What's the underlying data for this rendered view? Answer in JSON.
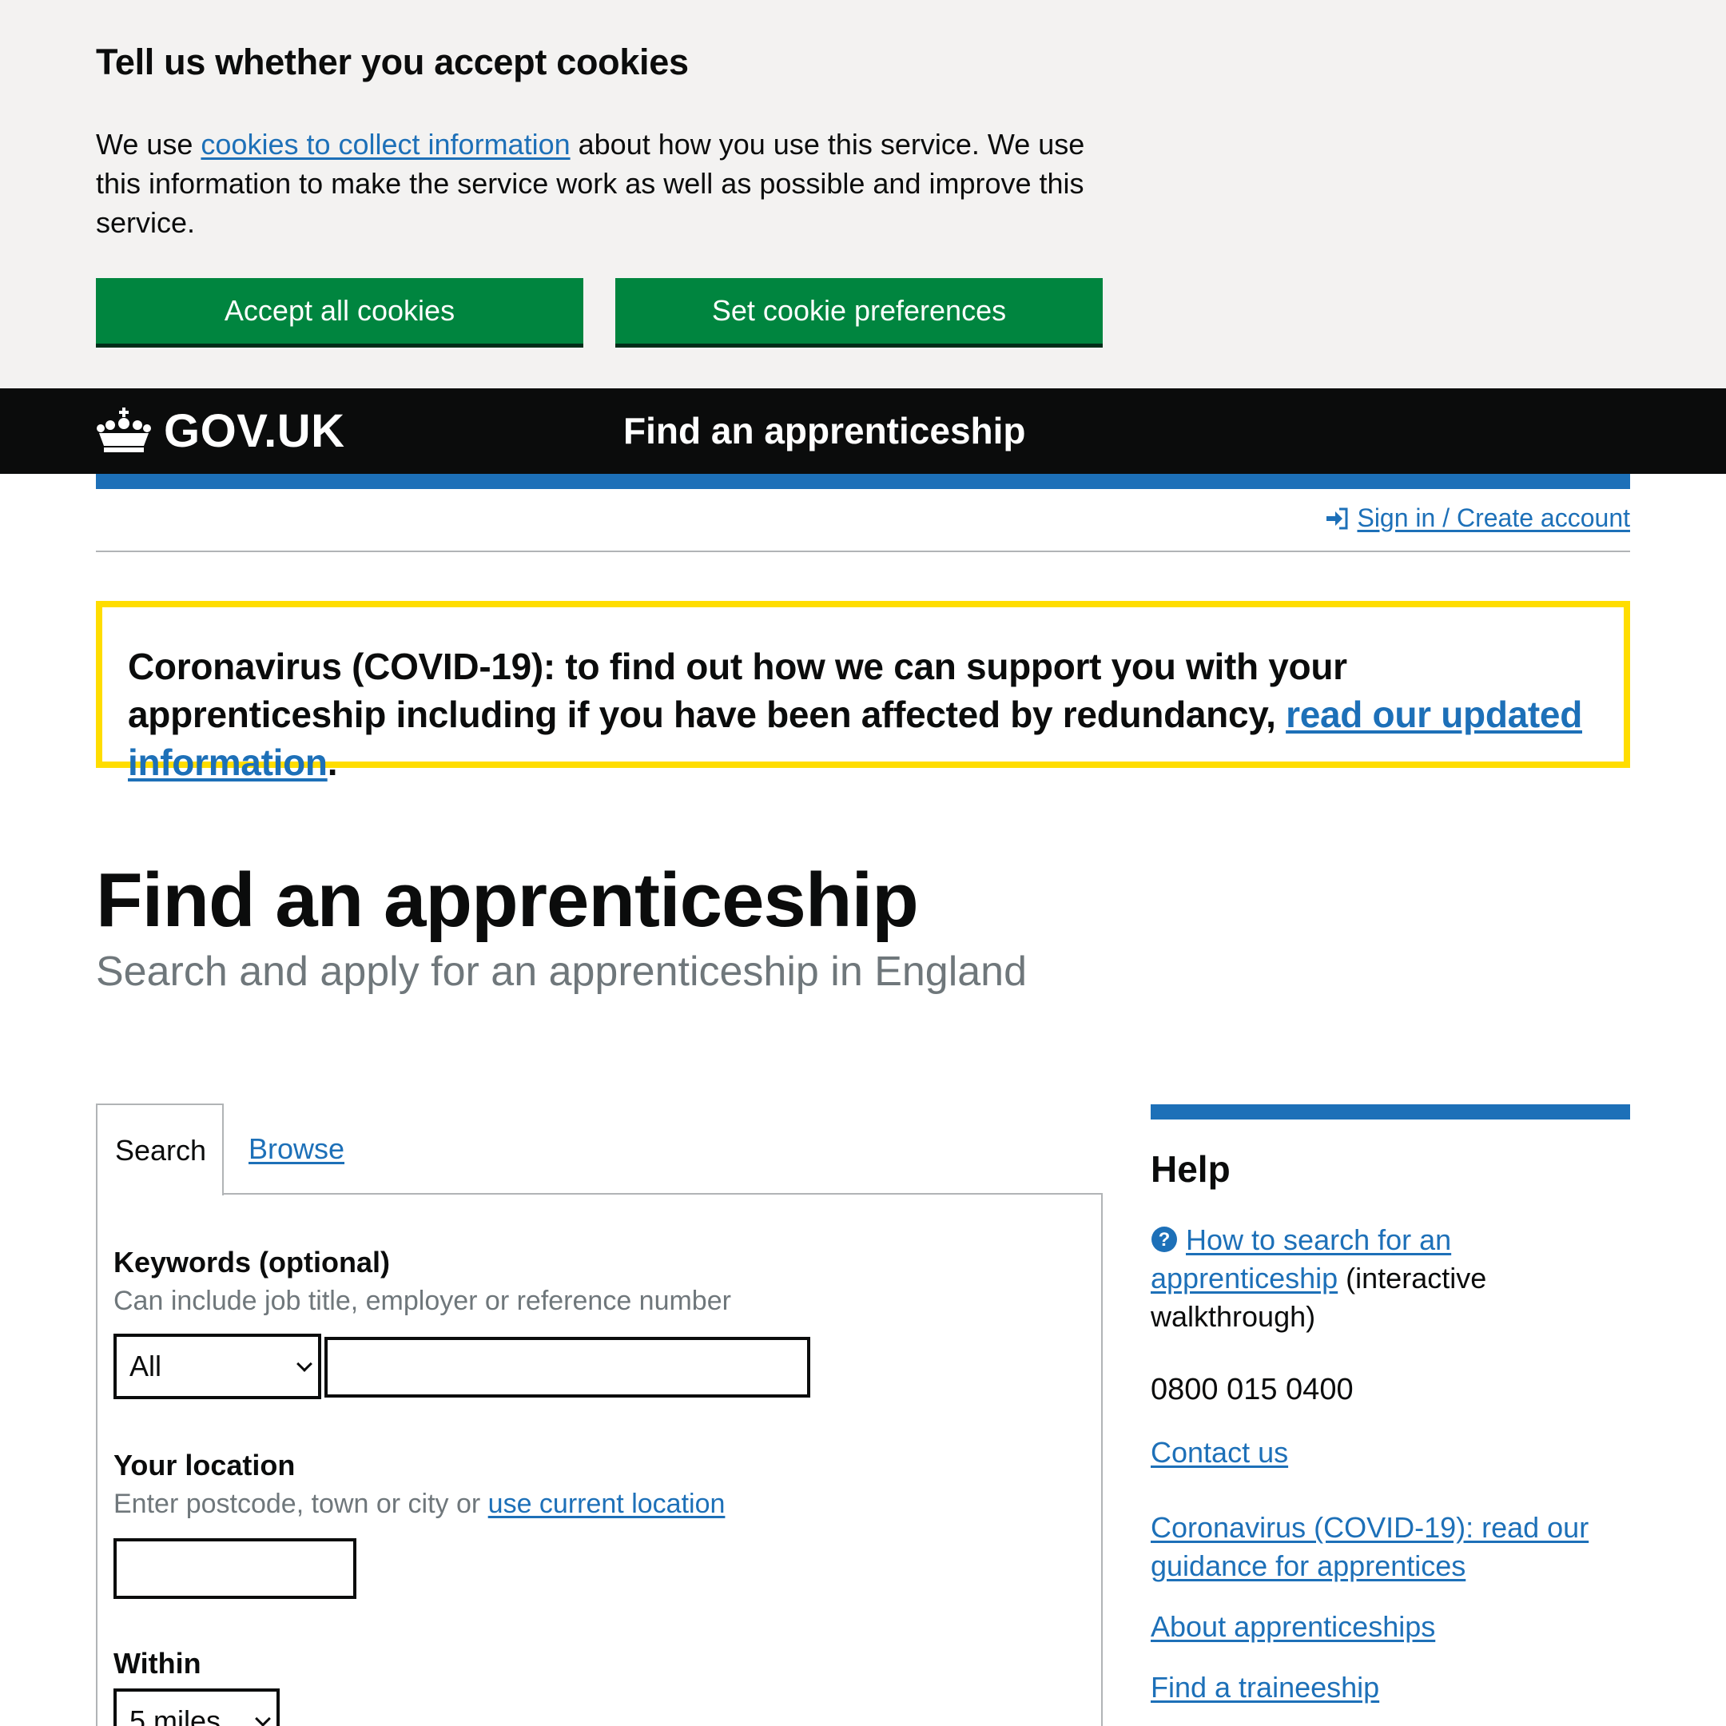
{
  "cookie_banner": {
    "title": "Tell us whether you accept cookies",
    "text_before": "We use ",
    "link_text": "cookies to collect information",
    "text_after": " about how you use this service. We use this information to make the service work as well as possible and improve this service.",
    "accept_label": "Accept all cookies",
    "prefs_label": "Set cookie preferences"
  },
  "header": {
    "logo_text": "GOV.UK",
    "service_name": "Find an apprenticeship"
  },
  "account_nav": {
    "signin_label": "Sign in / Create account"
  },
  "covid_banner": {
    "text": "Coronavirus (COVID-19): to find out how we can support you with your apprenticeship including if you have been affected by redundancy, ",
    "link_text": "read our updated information",
    "end": "."
  },
  "main": {
    "title": "Find an apprenticeship",
    "subtitle": "Search and apply for an apprenticeship in England"
  },
  "tabs": [
    {
      "label": "Search",
      "selected": true
    },
    {
      "label": "Browse",
      "selected": false
    }
  ],
  "search_form": {
    "keywords_label": "Keywords (optional)",
    "keywords_hint": "Can include job title, employer or reference number",
    "keywords_scope_selected": "All",
    "keywords_value": "",
    "location_label": "Your location",
    "location_hint": "Enter postcode, town or city or ",
    "location_hint_link": "use current location",
    "location_value": "",
    "within_label": "Within",
    "within_selected": "5 miles"
  },
  "help": {
    "title": "Help",
    "walkthrough_link": "How to search for an apprenticeship",
    "walkthrough_suffix": " (interactive walkthrough)",
    "phone": "0800 015 0400",
    "contact_link": "Contact us",
    "covid_guidance_link": "Coronavirus (COVID-19): read our guidance for apprentices",
    "about_link": "About apprenticeships",
    "traineeship_link": "Find a traineeship"
  },
  "colors": {
    "brand_green": "#00853f",
    "link_blue": "#1d70b8",
    "header_black": "#0b0c0c",
    "banner_yellow": "#ffdd00",
    "banner_grey": "#f3f2f1"
  }
}
